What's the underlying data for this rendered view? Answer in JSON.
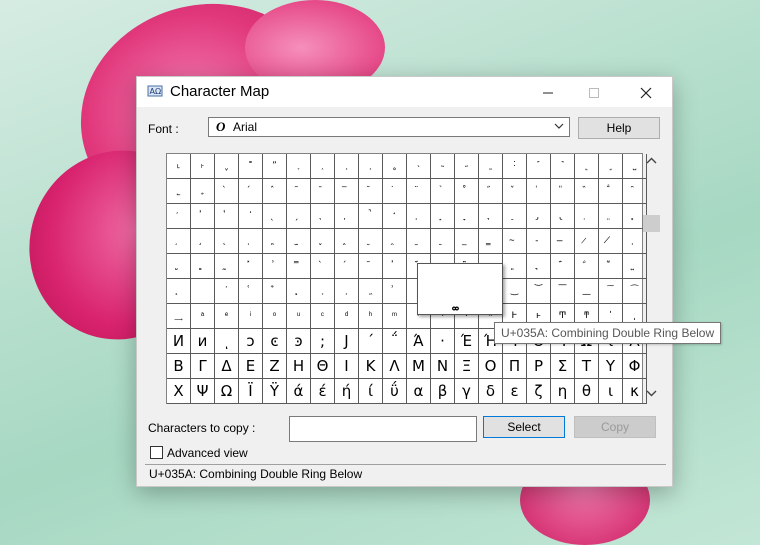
{
  "window": {
    "title": "Character Map",
    "minimize_icon": "minimize-icon",
    "maximize_icon": "maximize-icon",
    "close_icon": "close-icon"
  },
  "font": {
    "label": "Font :",
    "value": "Arial",
    "type_icon": "opentype-font-icon",
    "dropdown_icon": "chevron-down-icon"
  },
  "help_button": "Help",
  "grid": {
    "columns": 20,
    "rows": [
      [
        "˪",
        "˫",
        "ˬ",
        "˭",
        "ˮ",
        "˯",
        "˰",
        "˱",
        "˲",
        "˳",
        "˴",
        "˵",
        "˶",
        "˷",
        "˸",
        "˹",
        "˺",
        "˻",
        "˼",
        "˽"
      ],
      [
        "˾",
        "˿",
        "̀",
        "́",
        "̂",
        "̃",
        "̄",
        "̅",
        "̆",
        "̇",
        "̈",
        "̉",
        "̊",
        "̋",
        "̌",
        "̍",
        "̎",
        "̏",
        "̐",
        "̑"
      ],
      [
        "̒",
        "̓",
        "̔",
        "̕",
        "̖",
        "̗",
        "̘",
        "̙",
        "̚",
        "̛",
        "̜",
        "̝",
        "̞",
        "̟",
        "̠",
        "̡",
        "̢",
        "̣",
        "̤",
        "̥"
      ],
      [
        "̦",
        "̧",
        "̨",
        "̩",
        "̪",
        "̫",
        "̬",
        "̭",
        "̮",
        "̯",
        "̰",
        "̱",
        "̲",
        "̳",
        "̴",
        "̵",
        "̶",
        "̷",
        "̸",
        "̹"
      ],
      [
        "̺",
        "̻",
        "̼",
        "̽",
        "̾",
        "̿",
        "̀",
        "́",
        "͂",
        "̓",
        "̈́",
        "ͅ",
        "͆",
        "͇",
        "͈",
        "͉",
        "͊",
        "͋",
        "͌",
        "͍"
      ],
      [
        "͎",
        "͏",
        "͐",
        "͑",
        "͒",
        "͓",
        "͔",
        "͕",
        "͖",
        "͗",
        "͘",
        "͙",
        "͚",
        "͛",
        "͜",
        "͝",
        "͞",
        "͟",
        "͠",
        "͡"
      ],
      [
        "͢",
        "ͣ",
        "ͤ",
        "ͥ",
        "ͦ",
        "ͧ",
        "ͨ",
        "ͩ",
        "ͪ",
        "ͫ",
        "ͬ",
        "ͭ",
        "ͮ",
        "ͯ",
        "Ͱ",
        "ͱ",
        "Ͳ",
        "ͳ",
        "ʹ",
        "͵"
      ],
      [
        "Ͷ",
        "ͷ",
        "ͺ",
        "ͻ",
        "ͼ",
        "ͽ",
        ";",
        "Ϳ",
        "΄",
        "΅",
        "Ά",
        "·",
        "Έ",
        "Ή",
        "Ί",
        "Ό",
        "Ύ",
        "Ώ",
        "ΐ",
        "Α"
      ],
      [
        "Β",
        "Γ",
        "Δ",
        "Ε",
        "Ζ",
        "Η",
        "Θ",
        "Ι",
        "Κ",
        "Λ",
        "Μ",
        "Ν",
        "Ξ",
        "Ο",
        "Π",
        "Ρ",
        "Σ",
        "Τ",
        "Υ",
        "Φ"
      ],
      [
        "Χ",
        "Ψ",
        "Ω",
        "Ϊ",
        "Ϋ",
        "ά",
        "έ",
        "ή",
        "ί",
        "ΰ",
        "α",
        "β",
        "γ",
        "δ",
        "ε",
        "ζ",
        "η",
        "θ",
        "ι",
        "κ"
      ]
    ]
  },
  "magnified_char": "͚",
  "tooltip": "U+035A: Combining Double Ring Below",
  "scroll": {
    "up_icon": "chevron-up-icon",
    "down_icon": "chevron-down-icon"
  },
  "copy": {
    "label": "Characters to copy :",
    "value": "",
    "select_button": "Select",
    "copy_button": "Copy"
  },
  "advanced_view": {
    "label": "Advanced view",
    "checked": false
  },
  "status": "U+035A: Combining Double Ring Below",
  "colors": {
    "accent": "#0078d7",
    "flower": "#e0367a",
    "background": "#b9e0cf"
  }
}
